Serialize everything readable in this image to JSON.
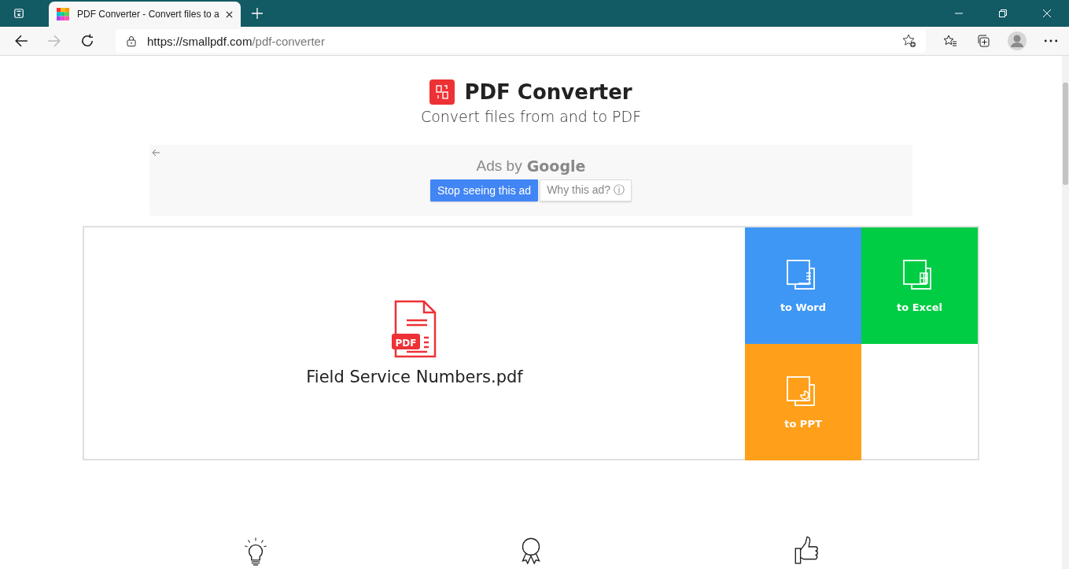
{
  "browser": {
    "tab_title": "PDF Converter - Convert files to a",
    "url_host": "https://smallpdf.com",
    "url_path": "/pdf-converter"
  },
  "header": {
    "title": "PDF Converter",
    "subtitle": "Convert files from and to PDF"
  },
  "ad": {
    "label": "Ads by",
    "brand": "Google",
    "buttons": [
      "Stop seeing this ad",
      "Why this ad? ⓘ"
    ]
  },
  "file": {
    "name": "Field Service Numbers.pdf",
    "badge": "PDF"
  },
  "options": [
    {
      "label": "to Word",
      "kind": "word",
      "color": "#3f97f5"
    },
    {
      "label": "to Excel",
      "kind": "excel",
      "color": "#00cc44"
    },
    {
      "label": "to PPT",
      "kind": "ppt",
      "color": "#ff9f1a"
    }
  ],
  "features": [
    {
      "kind": "bulb"
    },
    {
      "kind": "award"
    },
    {
      "kind": "thumb"
    }
  ]
}
